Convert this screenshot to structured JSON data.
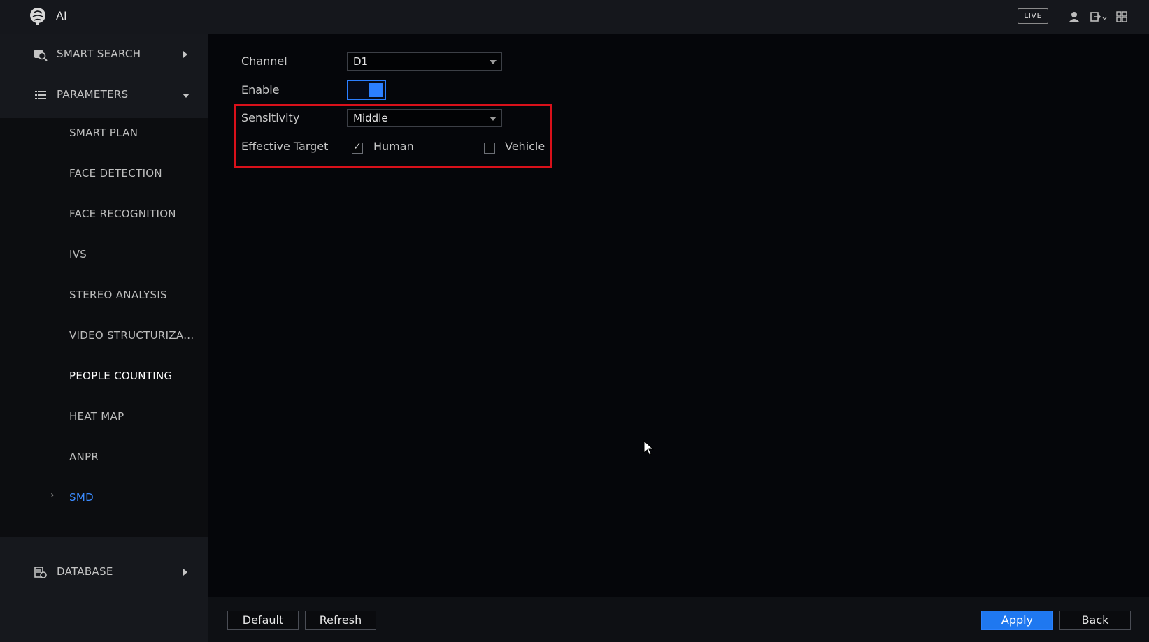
{
  "header": {
    "title": "AI",
    "live_label": "LIVE",
    "icons": [
      "brain-logo-icon",
      "user-icon",
      "logout-icon",
      "grid-menu-icon"
    ]
  },
  "sidebar": {
    "sections": [
      {
        "label": "SMART SEARCH",
        "icon": "search-icon",
        "state": "collapsed"
      },
      {
        "label": "PARAMETERS",
        "icon": "list-icon",
        "state": "expanded"
      },
      {
        "label": "DATABASE",
        "icon": "database-icon",
        "state": "collapsed"
      }
    ],
    "parameters_items": [
      "SMART PLAN",
      "FACE DETECTION",
      "FACE RECOGNITION",
      "IVS",
      "STEREO ANALYSIS",
      "VIDEO STRUCTURIZA...",
      "PEOPLE COUNTING",
      "HEAT MAP",
      "ANPR",
      "SMD"
    ],
    "selected_item": "SMD"
  },
  "form": {
    "channel_label": "Channel",
    "channel_value": "D1",
    "enable_label": "Enable",
    "enable_on": true,
    "sensitivity_label": "Sensitivity",
    "sensitivity_value": "Middle",
    "effective_target_label": "Effective Target",
    "human_label": "Human",
    "human_checked": true,
    "vehicle_label": "Vehicle",
    "vehicle_checked": false,
    "highlight_color": "#d9101a"
  },
  "footer": {
    "default_label": "Default",
    "refresh_label": "Refresh",
    "apply_label": "Apply",
    "back_label": "Back"
  },
  "colors": {
    "accent": "#1f78f0",
    "active_item": "#3b8bff"
  }
}
